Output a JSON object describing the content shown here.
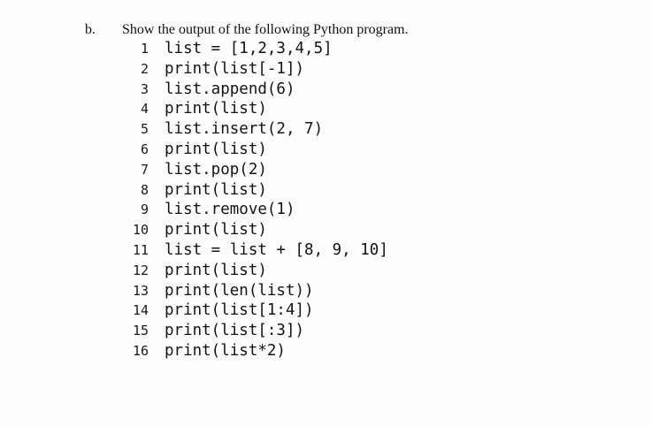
{
  "question": {
    "marker": "b.",
    "prompt": "Show the output of the following Python program."
  },
  "code": {
    "lines": [
      {
        "number": "1",
        "text": "list = [1,2,3,4,5]"
      },
      {
        "number": "2",
        "text": "print(list[-1])"
      },
      {
        "number": "3",
        "text": "list.append(6)"
      },
      {
        "number": "4",
        "text": "print(list)"
      },
      {
        "number": "5",
        "text": "list.insert(2, 7)"
      },
      {
        "number": "6",
        "text": "print(list)"
      },
      {
        "number": "7",
        "text": "list.pop(2)"
      },
      {
        "number": "8",
        "text": "print(list)"
      },
      {
        "number": "9",
        "text": "list.remove(1)"
      },
      {
        "number": "10",
        "text": "print(list)"
      },
      {
        "number": "11",
        "text": "list = list + [8, 9, 10]"
      },
      {
        "number": "12",
        "text": "print(list)"
      },
      {
        "number": "13",
        "text": "print(len(list))"
      },
      {
        "number": "14",
        "text": "print(list[1:4])"
      },
      {
        "number": "15",
        "text": "print(list[:3])"
      },
      {
        "number": "16",
        "text": "print(list*2)"
      }
    ]
  }
}
